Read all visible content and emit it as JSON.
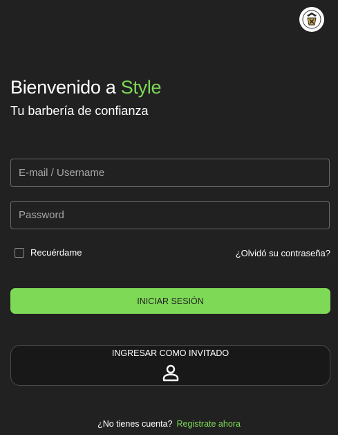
{
  "header": {
    "logo_icon": "barbershop-logo-icon"
  },
  "welcome": {
    "title_prefix": "Bienvenido a",
    "title_brand": "Style",
    "subtitle": "Tu barbería de confianza"
  },
  "form": {
    "email_placeholder": "E-mail / Username",
    "email_value": "",
    "password_placeholder": "Password",
    "password_value": "",
    "remember_label": "Recuérdame",
    "remember_checked": false,
    "forgot_label": "¿Olvidó su contraseña?"
  },
  "actions": {
    "login_label": "INICIAR SESIÓN",
    "guest_label": "INGRESAR COMO INVITADO",
    "guest_icon": "person-icon"
  },
  "footer": {
    "question": "¿No tienes cuenta?",
    "register_link": "Registrate ahora"
  },
  "colors": {
    "background": "#212121",
    "accent": "#7ed957",
    "guest_button": "#181818"
  }
}
